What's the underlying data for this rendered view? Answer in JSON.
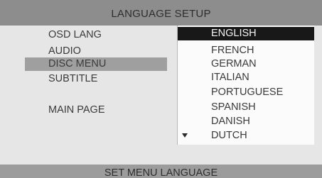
{
  "header": {
    "title": "LANGUAGE SETUP"
  },
  "menu": {
    "items": [
      {
        "label": "OSD LANG",
        "selected": false
      },
      {
        "label": "AUDIO",
        "selected": false
      },
      {
        "label": "DISC MENU",
        "selected": true
      },
      {
        "label": "SUBTITLE",
        "selected": false
      },
      {
        "label": "MAIN PAGE",
        "selected": false
      }
    ]
  },
  "languages": {
    "items": [
      {
        "label": "ENGLISH",
        "selected": true
      },
      {
        "label": "FRENCH",
        "selected": false
      },
      {
        "label": "GERMAN",
        "selected": false
      },
      {
        "label": "ITALIAN",
        "selected": false
      },
      {
        "label": "PORTUGUESE",
        "selected": false
      },
      {
        "label": "SPANISH",
        "selected": false
      },
      {
        "label": "DANISH",
        "selected": false
      },
      {
        "label": "DUTCH",
        "selected": false
      }
    ],
    "scroll_indicator": "down-arrow-icon"
  },
  "footer": {
    "hint": "SET MENU LANGUAGE"
  },
  "colors": {
    "title_bar": "#8d8d8d",
    "menu_highlight": "#9f9f9f",
    "list_highlight": "#181818",
    "list_background": "#fbfbfb"
  }
}
